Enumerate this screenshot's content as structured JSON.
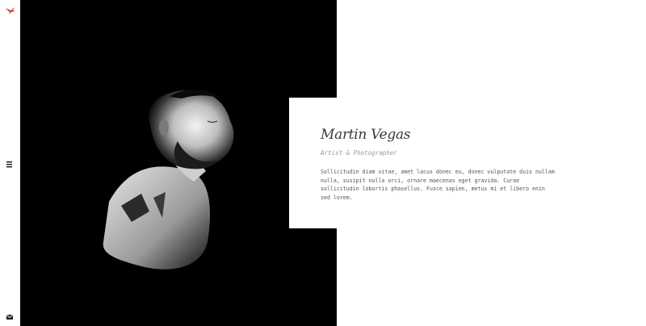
{
  "sidebar": {
    "logo_icon": "bird-logo-icon",
    "logo_color": "#d9474a",
    "menu_icon": "hamburger-menu-icon",
    "mail_icon": "envelope-icon"
  },
  "profile": {
    "name": "Martin Vegas",
    "role": "Artist & Photographer",
    "bio": "Sollicitudin diam vitae, amet lacus donec eu, donec vulputate duis nullam nulla, susipit nulla orci, ornare maecenas eget gravida. Curae sollicitudin lobortis phasellus. Fusce sapien, metus mi et libero enin sed lorem."
  },
  "colors": {
    "photo_background": "#000000",
    "card_background": "#ffffff",
    "name_text": "#3a3a3a",
    "role_text": "#9a9a9a",
    "body_text": "#555555"
  }
}
